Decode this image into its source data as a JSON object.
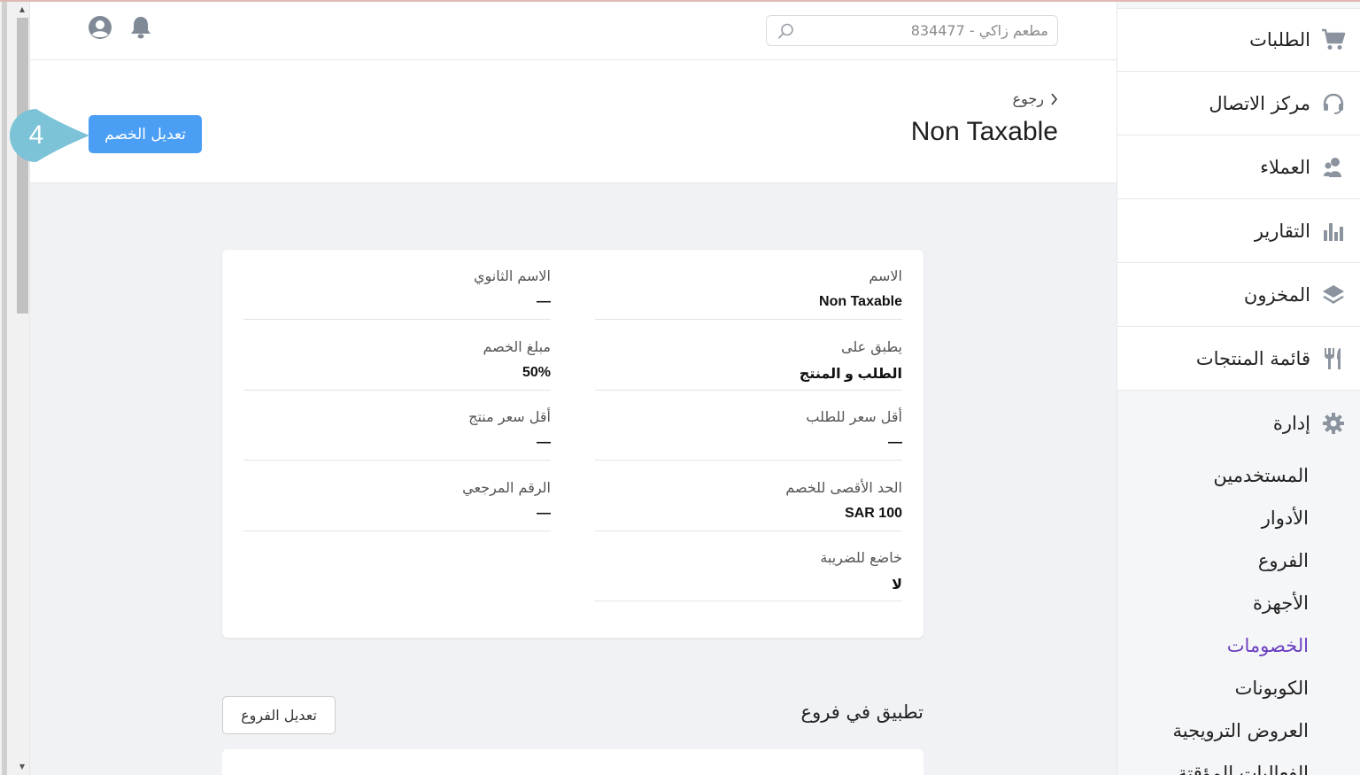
{
  "header": {
    "search_placeholder": "مطعم زاكي - 834477"
  },
  "page": {
    "back_label": "رجوع",
    "title": "Non Taxable",
    "edit_discount_label": "تعديل الخصم",
    "step_number": "4"
  },
  "details": {
    "name_label": "الاسم",
    "name_value": "Non Taxable",
    "secondary_name_label": "الاسم الثانوي",
    "secondary_name_value": "—",
    "applies_to_label": "يطبق على",
    "applies_to_value": "الطلب و المنتج",
    "discount_amount_label": "مبلغ الخصم",
    "discount_amount_value": "50%",
    "min_order_price_label": "أقل سعر للطلب",
    "min_order_price_value": "—",
    "min_product_price_label": "أقل سعر منتج",
    "min_product_price_value": "—",
    "max_discount_label": "الحد الأقصى للخصم",
    "max_discount_value": "SAR 100",
    "reference_label": "الرقم المرجعي",
    "reference_value": "—",
    "taxable_label": "خاضع للضريبة",
    "taxable_value": "لا"
  },
  "branches": {
    "title": "تطبيق في فروع",
    "edit_label": "تعديل الفروع"
  },
  "sidebar": {
    "items": [
      {
        "label": "الطلبات",
        "icon": "cart-icon"
      },
      {
        "label": "مركز الاتصال",
        "icon": "headset-icon"
      },
      {
        "label": "العملاء",
        "icon": "users-icon"
      },
      {
        "label": "التقارير",
        "icon": "chart-icon"
      },
      {
        "label": "المخزون",
        "icon": "layers-icon"
      },
      {
        "label": "قائمة المنتجات",
        "icon": "utensils-icon"
      }
    ],
    "admin": {
      "label": "إدارة",
      "icon": "gear-icon",
      "sub_items": [
        {
          "label": "المستخدمين"
        },
        {
          "label": "الأدوار"
        },
        {
          "label": "الفروع"
        },
        {
          "label": "الأجهزة"
        },
        {
          "label": "الخصومات",
          "active": true
        },
        {
          "label": "الكوبونات"
        },
        {
          "label": "العروض الترويجية"
        },
        {
          "label": "الفعاليات المؤقتة"
        }
      ]
    }
  },
  "colors": {
    "primary_button": "#4a9ff5",
    "callout": "#7cc3d8",
    "active_nav": "#6a3fc0"
  }
}
